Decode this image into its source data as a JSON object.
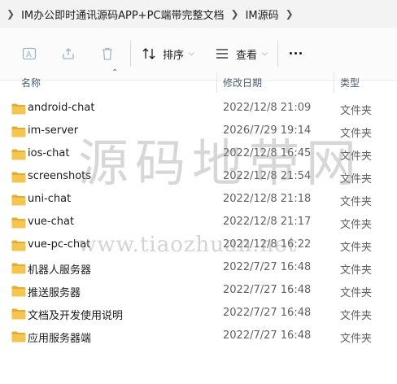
{
  "breadcrumb": [
    "IM办公即时通讯源码APP+PC端带完整文档",
    "IM源码"
  ],
  "toolbar": {
    "sort_label": "排序",
    "view_label": "查看"
  },
  "columns": {
    "name": "名称",
    "date": "修改日期",
    "type": "类型"
  },
  "files": [
    {
      "name": "android-chat",
      "date": "2022/12/8 21:09",
      "type": "文件夹"
    },
    {
      "name": "im-server",
      "date": "2026/7/29 19:14",
      "type": "文件夹"
    },
    {
      "name": "ios-chat",
      "date": "2022/12/8 16:45",
      "type": "文件夹"
    },
    {
      "name": "screenshots",
      "date": "2022/12/8 21:54",
      "type": "文件夹"
    },
    {
      "name": "uni-chat",
      "date": "2022/12/8 21:18",
      "type": "文件夹"
    },
    {
      "name": "vue-chat",
      "date": "2022/12/8 21:17",
      "type": "文件夹"
    },
    {
      "name": "vue-pc-chat",
      "date": "2022/12/8 16:22",
      "type": "文件夹"
    },
    {
      "name": "机器人服务器",
      "date": "2022/7/27 16:48",
      "type": "文件夹"
    },
    {
      "name": "推送服务器",
      "date": "2022/7/27 16:48",
      "type": "文件夹"
    },
    {
      "name": "文档及开发使用说明",
      "date": "2022/7/27 16:48",
      "type": "文件夹"
    },
    {
      "name": "应用服务器端",
      "date": "2022/7/27 16:48",
      "type": "文件夹"
    }
  ],
  "watermark": {
    "text": "源码地带网",
    "url": "www.tiaozhuan.net"
  },
  "colors": {
    "folder": "#f4c64f",
    "folder_dark": "#e5ad2f",
    "toolbar_bg": "#fbfbfb",
    "address_bg": "#f3f3f3"
  },
  "icons": [
    "chevron-right-icon",
    "rename-icon",
    "share-icon",
    "delete-icon",
    "sort-icon",
    "view-icon",
    "more-icon",
    "sort-up-icon",
    "folder-icon"
  ]
}
